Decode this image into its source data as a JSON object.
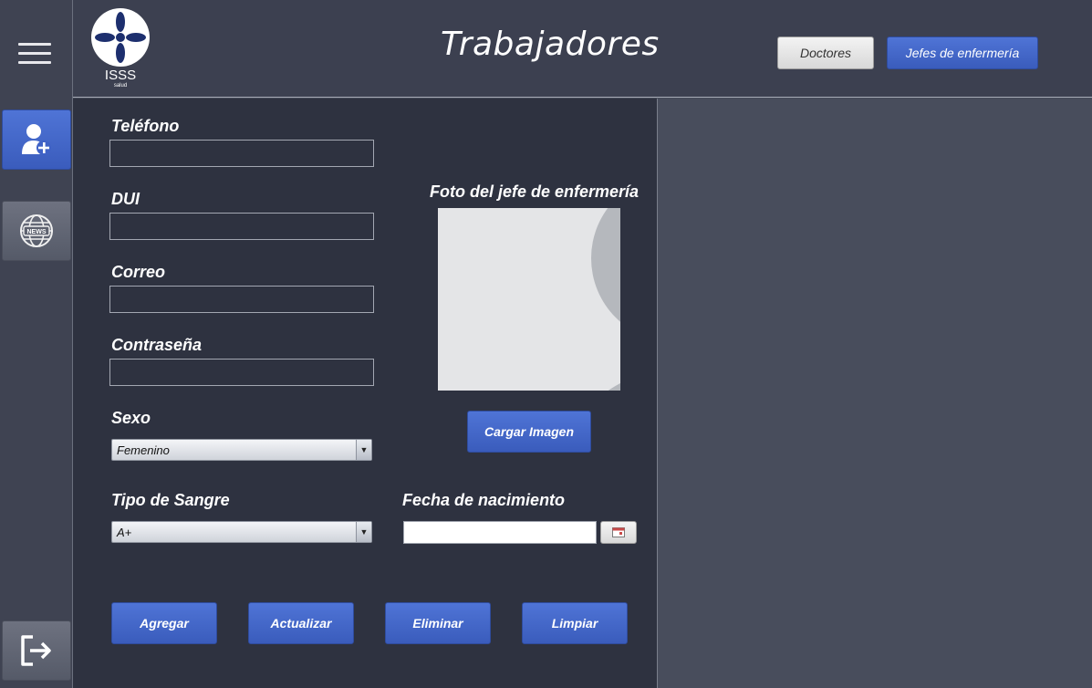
{
  "header": {
    "title": "Trabajadores",
    "logo_text": "ISSS",
    "logo_subtext": "salud",
    "buttons": {
      "doctores": "Doctores",
      "jefes": "Jefes de enfermería"
    }
  },
  "sidebar": {
    "items": [
      {
        "icon": "menu-icon"
      },
      {
        "icon": "add-user-icon",
        "active": true
      },
      {
        "icon": "news-globe-icon"
      },
      {
        "icon": "logout-icon"
      }
    ]
  },
  "form": {
    "telefono": {
      "label": "Teléfono",
      "value": ""
    },
    "dui": {
      "label": "DUI",
      "value": ""
    },
    "correo": {
      "label": "Correo",
      "value": ""
    },
    "contrasena": {
      "label": "Contraseña",
      "value": ""
    },
    "sexo": {
      "label": "Sexo",
      "value": "Femenino"
    },
    "tipo_sangre": {
      "label": "Tipo de Sangre",
      "value": "A+"
    },
    "fecha_nacimiento": {
      "label": "Fecha de nacimiento",
      "value": ""
    },
    "foto_label": "Foto del jefe de enfermería",
    "cargar_imagen": "Cargar Imagen"
  },
  "actions": {
    "agregar": "Agregar",
    "actualizar": "Actualizar",
    "eliminar": "Eliminar",
    "limpiar": "Limpiar"
  },
  "colors": {
    "accent_blue": "#4466cc",
    "panel_dark": "#2e3240",
    "background": "#454a59"
  }
}
